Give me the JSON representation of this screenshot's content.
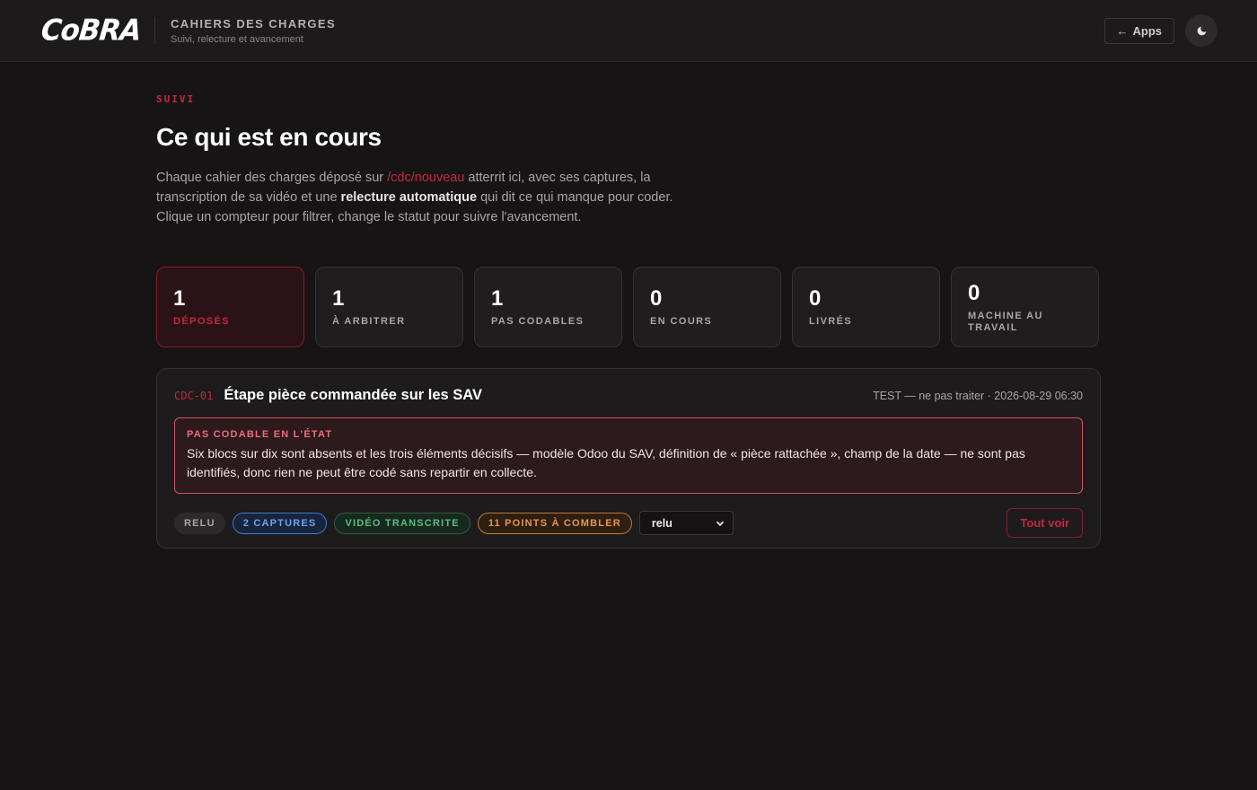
{
  "header": {
    "logo": "CoBRA",
    "title": "CAHIERS DES CHARGES",
    "subtitle": "Suivi, relecture et avancement",
    "apps_label": "Apps",
    "apps_arrow": "←",
    "theme_icon": "moon-icon"
  },
  "page": {
    "eyebrow": "SUIVI",
    "heading": "Ce qui est en cours",
    "intro": {
      "part1": "Chaque cahier des charges déposé sur ",
      "link": "/cdc/nouveau",
      "part2": " atterrit ici, avec ses captures, la transcription de sa vidéo et une ",
      "bold": "relecture automatique",
      "part3": " qui dit ce qui manque pour coder. Clique un compteur pour filtrer, change le statut pour suivre l'avancement."
    }
  },
  "stats": [
    {
      "value": "1",
      "label": "Déposés",
      "active": true
    },
    {
      "value": "1",
      "label": "À arbitrer",
      "active": false
    },
    {
      "value": "1",
      "label": "Pas codables",
      "active": false
    },
    {
      "value": "0",
      "label": "En cours",
      "active": false
    },
    {
      "value": "0",
      "label": "Livrés",
      "active": false
    },
    {
      "value": "0",
      "label": "Machine au travail",
      "active": false
    }
  ],
  "card": {
    "id": "CDC-01",
    "title": "Étape pièce commandée sur les SAV",
    "meta": "TEST — ne pas traiter · 2026-08-29 06:30",
    "alert_title": "PAS CODABLE EN L'ÉTAT",
    "alert_text": "Six blocs sur dix sont absents et les trois éléments décisifs — modèle Odoo du SAV, définition de « pièce rattachée », champ de la date — ne sont pas identifiés, donc rien ne peut être codé sans repartir en collecte.",
    "tags": {
      "relu": "RELU",
      "captures": "2 CAPTURES",
      "video": "VIDÉO TRANSCRITE",
      "points": "11 POINTS À COMBLER"
    },
    "status_value": "relu",
    "see_all": "Tout voir"
  },
  "colors": {
    "accent": "#c4283f",
    "background": "#161415",
    "card": "#1d1b1c"
  }
}
